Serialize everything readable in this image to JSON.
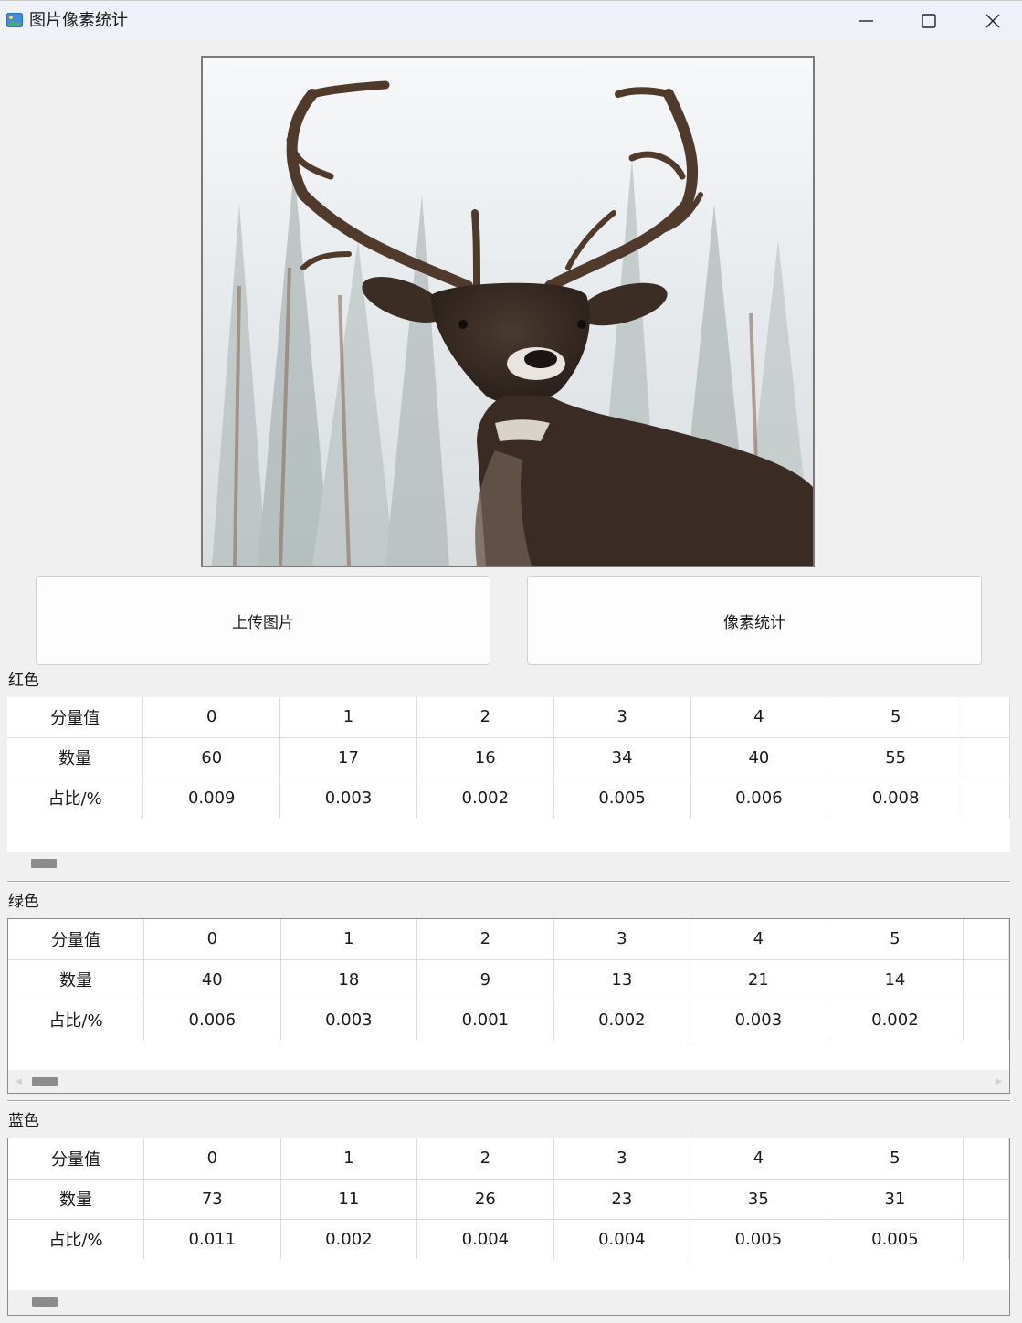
{
  "window": {
    "title": "图片像素统计",
    "icon": "image-app-icon",
    "controls": [
      "minimize-icon",
      "maximize-icon",
      "close-icon"
    ]
  },
  "image": {
    "alt": "deer-photo"
  },
  "buttons": {
    "upload": "上传图片",
    "stats": "像素统计"
  },
  "tables": {
    "red": {
      "label": "红色",
      "rows": [
        [
          "分量值",
          "0",
          "1",
          "2",
          "3",
          "4",
          "5"
        ],
        [
          "数量",
          "60",
          "17",
          "16",
          "34",
          "40",
          "55"
        ],
        [
          "占比/%",
          "0.009",
          "0.003",
          "0.002",
          "0.005",
          "0.006",
          "0.008"
        ]
      ]
    },
    "green": {
      "label": "绿色",
      "rows": [
        [
          "分量值",
          "0",
          "1",
          "2",
          "3",
          "4",
          "5"
        ],
        [
          "数量",
          "40",
          "18",
          "9",
          "13",
          "21",
          "14"
        ],
        [
          "占比/%",
          "0.006",
          "0.003",
          "0.001",
          "0.002",
          "0.003",
          "0.002"
        ]
      ]
    },
    "blue": {
      "label": "蓝色",
      "rows": [
        [
          "分量值",
          "0",
          "1",
          "2",
          "3",
          "4",
          "5"
        ],
        [
          "数量",
          "73",
          "11",
          "26",
          "23",
          "35",
          "31"
        ],
        [
          "占比/%",
          "0.011",
          "0.002",
          "0.004",
          "0.004",
          "0.005",
          "0.005"
        ]
      ]
    }
  },
  "colors": {
    "window_bg": "#f0f0f0",
    "titlebar_bg": "#eef1f8",
    "grid_line": "#dcdcdc",
    "scroll_thumb": "#8c8c8c"
  }
}
